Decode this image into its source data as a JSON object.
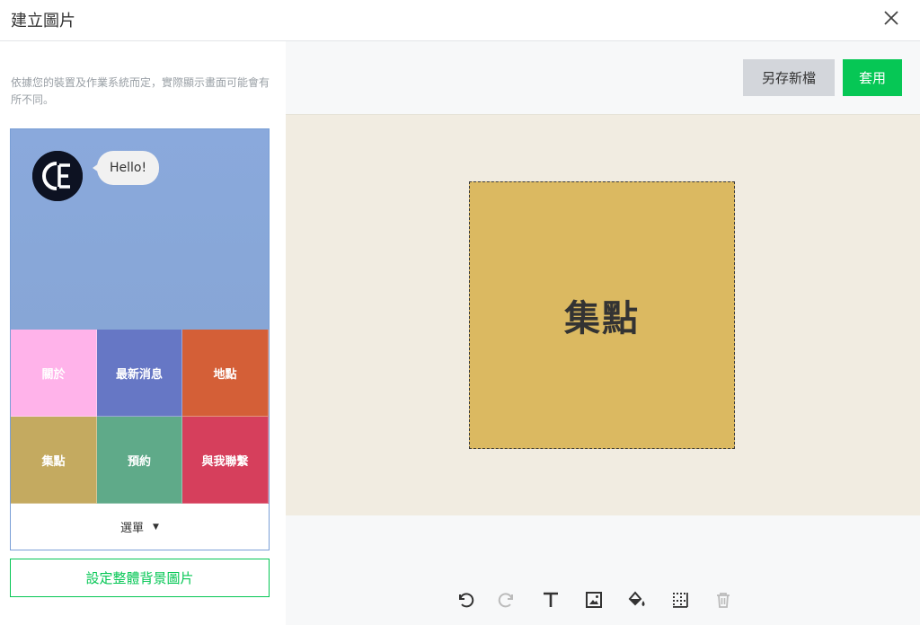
{
  "dialog": {
    "title": "建立圖片"
  },
  "preview": {
    "notice": "依據您的裝置及作業系統而定，實際顯示畫面可能會有所不同。",
    "chat_message": "Hello!",
    "grid_cells": [
      {
        "label": "關於",
        "color": "#ffb3ea"
      },
      {
        "label": "最新消息",
        "color": "#6677c5"
      },
      {
        "label": "地點",
        "color": "#d45f37"
      },
      {
        "label": "集點",
        "color": "#c4aa60"
      },
      {
        "label": "預約",
        "color": "#5faa89"
      },
      {
        "label": "與我聯繫",
        "color": "#d63f5c"
      }
    ],
    "menu_label": "選單",
    "menu_caret": "▼",
    "set_background_label": "設定整體背景圖片"
  },
  "editor": {
    "save_as_label": "另存新檔",
    "apply_label": "套用",
    "tile_text": "集點",
    "tile_color": "#dbb961",
    "accent_color": "#06c755"
  },
  "tools": [
    {
      "name": "undo-icon",
      "enabled": true
    },
    {
      "name": "redo-icon",
      "enabled": false
    },
    {
      "name": "text-icon",
      "enabled": true
    },
    {
      "name": "image-icon",
      "enabled": true
    },
    {
      "name": "fill-color-icon",
      "enabled": true
    },
    {
      "name": "border-icon",
      "enabled": true
    },
    {
      "name": "delete-icon",
      "enabled": false
    }
  ]
}
